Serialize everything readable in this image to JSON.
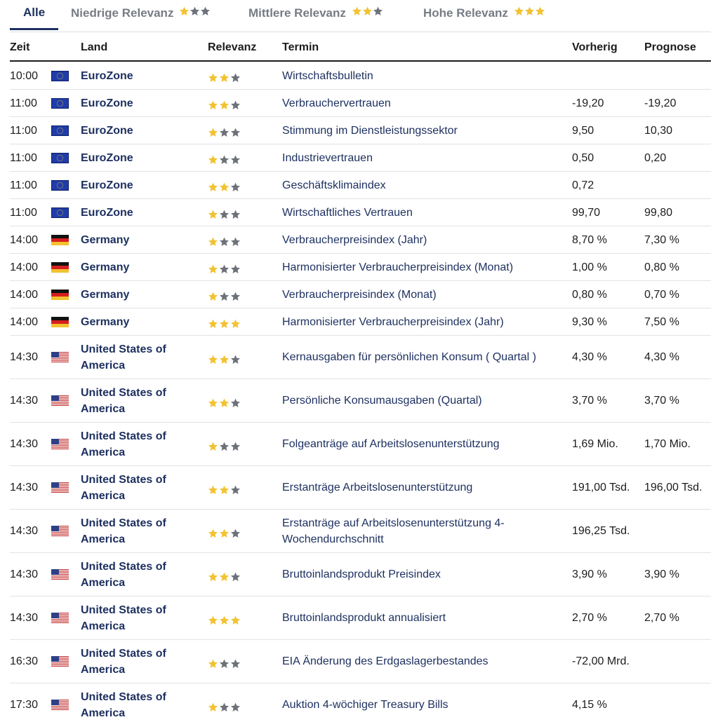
{
  "tabs": [
    {
      "label": "Alle",
      "stars": 0,
      "active": true
    },
    {
      "label": "Niedrige Relevanz",
      "stars": 1,
      "active": false
    },
    {
      "label": "Mittlere Relevanz",
      "stars": 2,
      "active": false
    },
    {
      "label": "Hohe Relevanz",
      "stars": 3,
      "active": false
    }
  ],
  "columns": {
    "time": "Zeit",
    "country": "Land",
    "relevance": "Relevanz",
    "event": "Termin",
    "previous": "Vorherig",
    "forecast": "Prognose"
  },
  "colors": {
    "star_filled": "#f2c230",
    "star_empty": "#6d717a",
    "link": "#1c2f5f"
  },
  "rows": [
    {
      "time": "10:00",
      "flag": "eu",
      "country": "EuroZone",
      "stars": 2,
      "event": "Wirtschaftsbulletin",
      "previous": "",
      "forecast": ""
    },
    {
      "time": "11:00",
      "flag": "eu",
      "country": "EuroZone",
      "stars": 2,
      "event": "Verbrauchervertrauen",
      "previous": "-19,20",
      "forecast": "-19,20"
    },
    {
      "time": "11:00",
      "flag": "eu",
      "country": "EuroZone",
      "stars": 1,
      "event": "Stimmung im Dienstleistungssektor",
      "previous": "9,50",
      "forecast": "10,30"
    },
    {
      "time": "11:00",
      "flag": "eu",
      "country": "EuroZone",
      "stars": 1,
      "event": "Industrievertrauen",
      "previous": "0,50",
      "forecast": "0,20"
    },
    {
      "time": "11:00",
      "flag": "eu",
      "country": "EuroZone",
      "stars": 2,
      "event": "Geschäftsklimaindex",
      "previous": "0,72",
      "forecast": ""
    },
    {
      "time": "11:00",
      "flag": "eu",
      "country": "EuroZone",
      "stars": 1,
      "event": "Wirtschaftliches Vertrauen",
      "previous": "99,70",
      "forecast": "99,80"
    },
    {
      "time": "14:00",
      "flag": "de",
      "country": "Germany",
      "stars": 1,
      "event": "Verbraucherpreisindex (Jahr)",
      "previous": "8,70 %",
      "forecast": "7,30 %"
    },
    {
      "time": "14:00",
      "flag": "de",
      "country": "Germany",
      "stars": 1,
      "event": "Harmonisierter Verbraucherpreisindex (Monat)",
      "previous": "1,00 %",
      "forecast": "0,80 %"
    },
    {
      "time": "14:00",
      "flag": "de",
      "country": "Germany",
      "stars": 1,
      "event": "Verbraucherpreisindex (Monat)",
      "previous": "0,80 %",
      "forecast": "0,70 %"
    },
    {
      "time": "14:00",
      "flag": "de",
      "country": "Germany",
      "stars": 3,
      "event": "Harmonisierter Verbraucherpreisindex (Jahr)",
      "previous": "9,30 %",
      "forecast": "7,50 %"
    },
    {
      "time": "14:30",
      "flag": "us",
      "country": "United States of America",
      "stars": 2,
      "event": "Kernausgaben für persönlichen Konsum ( Quartal )",
      "previous": "4,30 %",
      "forecast": "4,30 %"
    },
    {
      "time": "14:30",
      "flag": "us",
      "country": "United States of America",
      "stars": 2,
      "event": "Persönliche Konsumausgaben (Quartal)",
      "previous": "3,70 %",
      "forecast": "3,70 %"
    },
    {
      "time": "14:30",
      "flag": "us",
      "country": "United States of America",
      "stars": 1,
      "event": "Folgeanträge auf Arbeitslosenunterstützung",
      "previous": "1,69 Mio.",
      "forecast": "1,70 Mio."
    },
    {
      "time": "14:30",
      "flag": "us",
      "country": "United States of America",
      "stars": 2,
      "event": "Erstanträge Arbeitslosenunterstützung",
      "previous": "191,00 Tsd.",
      "forecast": "196,00 Tsd."
    },
    {
      "time": "14:30",
      "flag": "us",
      "country": "United States of America",
      "stars": 2,
      "event": "Erstanträge auf Arbeitslosenunterstützung 4-Wochendurchschnitt",
      "previous": "196,25 Tsd.",
      "forecast": ""
    },
    {
      "time": "14:30",
      "flag": "us",
      "country": "United States of America",
      "stars": 2,
      "event": "Bruttoinlandsprodukt Preisindex",
      "previous": "3,90 %",
      "forecast": "3,90 %"
    },
    {
      "time": "14:30",
      "flag": "us",
      "country": "United States of America",
      "stars": 3,
      "event": "Bruttoinlandsprodukt annualisiert",
      "previous": "2,70 %",
      "forecast": "2,70 %"
    },
    {
      "time": "16:30",
      "flag": "us",
      "country": "United States of America",
      "stars": 1,
      "event": "EIA Änderung des Erdgaslagerbestandes",
      "previous": "-72,00 Mrd.",
      "forecast": ""
    },
    {
      "time": "17:30",
      "flag": "us",
      "country": "United States of America",
      "stars": 1,
      "event": "Auktion 4-wöchiger Treasury Bills",
      "previous": "4,15 %",
      "forecast": ""
    }
  ]
}
